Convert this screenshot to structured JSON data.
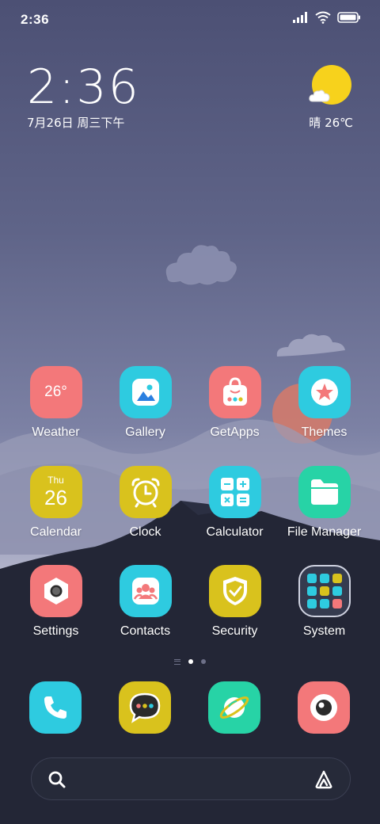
{
  "status_bar": {
    "time": "2:36",
    "icons": [
      "signal-icon",
      "wifi-icon",
      "battery-icon"
    ]
  },
  "clock_widget": {
    "time": "2:36",
    "date": "7月26日 周三下午"
  },
  "weather_widget": {
    "condition_temp": "晴 26℃",
    "icon": "sunny-cloud-icon"
  },
  "apps": [
    {
      "label": "Weather",
      "icon": "weather-icon",
      "text": "26°",
      "color": "#f3787a"
    },
    {
      "label": "Gallery",
      "icon": "gallery-icon",
      "color": "#2ecbe0"
    },
    {
      "label": "GetApps",
      "icon": "getapps-icon",
      "color": "#f3787a"
    },
    {
      "label": "Themes",
      "icon": "themes-icon",
      "color": "#2ecbe0"
    },
    {
      "label": "Calendar",
      "icon": "calendar-icon",
      "day_name": "Thu",
      "day_num": "26",
      "color": "#d9c21d"
    },
    {
      "label": "Clock",
      "icon": "alarm-clock-icon",
      "color": "#d9c21d"
    },
    {
      "label": "Calculator",
      "icon": "calculator-icon",
      "color": "#2ecbe0"
    },
    {
      "label": "File Manager",
      "icon": "folder-icon",
      "color": "#27d3a6"
    },
    {
      "label": "Settings",
      "icon": "settings-icon",
      "color": "#f3787a"
    },
    {
      "label": "Contacts",
      "icon": "contacts-icon",
      "color": "#2ecbe0"
    },
    {
      "label": "Security",
      "icon": "security-shield-icon",
      "color": "#d9c21d"
    },
    {
      "label": "System",
      "icon": "system-folder-icon"
    }
  ],
  "page_indicator": {
    "pages": 2,
    "active": 1
  },
  "dock": [
    {
      "icon": "phone-icon",
      "color": "#2ecbe0"
    },
    {
      "icon": "messaging-icon",
      "color": "#d9c21d"
    },
    {
      "icon": "browser-icon",
      "color": "#27d3a6"
    },
    {
      "icon": "camera-icon",
      "color": "#f3787a"
    }
  ],
  "search_bar": {
    "left_icon": "search-icon",
    "right_icon": "assistant-icon"
  }
}
